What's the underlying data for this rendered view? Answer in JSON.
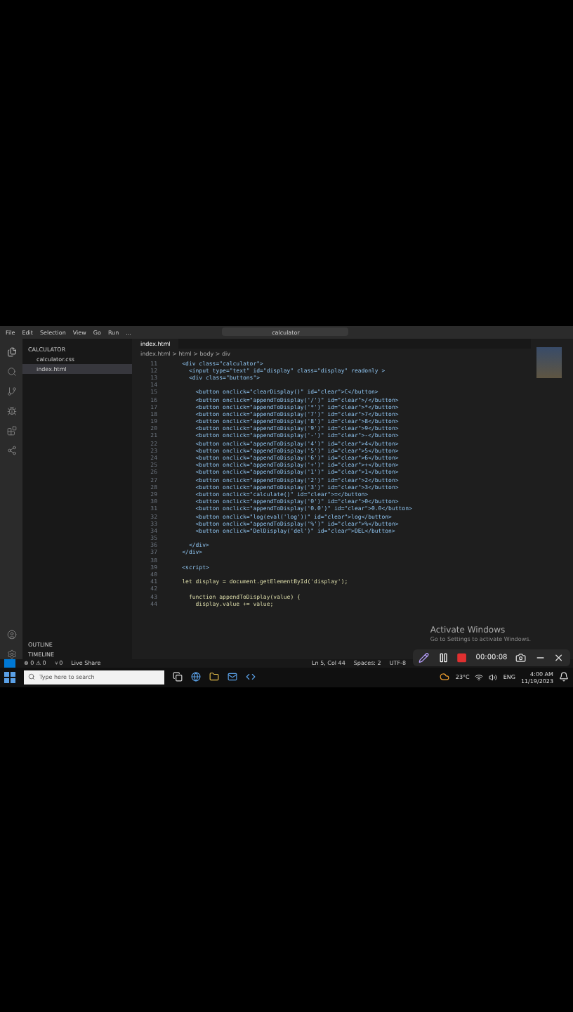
{
  "window": {
    "menu": [
      "File",
      "Edit",
      "Selection",
      "View",
      "Go",
      "Run",
      "..."
    ],
    "search": "calculator"
  },
  "sidebar": {
    "folder": "CALCULATOR",
    "files": [
      {
        "name": "calculator.css",
        "selected": false
      },
      {
        "name": "index.html",
        "selected": true
      }
    ],
    "panels": [
      "OUTLINE",
      "TIMELINE"
    ]
  },
  "editor": {
    "tab": "index.html",
    "breadcrumb": "index.html > html > body > div",
    "lines": [
      {
        "number": "11",
        "text": "    <div class=\"calculator\">",
        "kind": "markup"
      },
      {
        "number": "12",
        "text": "      <input type=\"text\" id=\"display\" class=\"display\" readonly >",
        "kind": "markup"
      },
      {
        "number": "13",
        "text": "      <div class=\"buttons\">",
        "kind": "markup"
      },
      {
        "number": "14",
        "kind": "blank"
      },
      {
        "number": "15",
        "text": "        <button onclick=\"clearDisplay()\" id=\"clear\">C</button>",
        "kind": "markup"
      },
      {
        "number": "16",
        "text": "        <button onclick=\"appendToDisplay('/')\" id=\"clear\">/</button>",
        "kind": "markup"
      },
      {
        "number": "17",
        "text": "        <button onclick=\"appendToDisplay('*')\" id=\"clear\">*</button>",
        "kind": "markup"
      },
      {
        "number": "18",
        "text": "        <button onclick=\"appendToDisplay('7')\" id=\"clear\">7</button>",
        "kind": "markup"
      },
      {
        "number": "19",
        "text": "        <button onclick=\"appendToDisplay('8')\" id=\"clear\">8</button>",
        "kind": "markup"
      },
      {
        "number": "20",
        "text": "        <button onclick=\"appendToDisplay('9')\" id=\"clear\">9</button>",
        "kind": "markup"
      },
      {
        "number": "21",
        "text": "        <button onclick=\"appendToDisplay('-')\" id=\"clear\">-</button>",
        "kind": "markup"
      },
      {
        "number": "22",
        "text": "        <button onclick=\"appendToDisplay('4')\" id=\"clear\">4</button>",
        "kind": "markup"
      },
      {
        "number": "23",
        "text": "        <button onclick=\"appendToDisplay('5')\" id=\"clear\">5</button>",
        "kind": "markup"
      },
      {
        "number": "24",
        "text": "        <button onclick=\"appendToDisplay('6')\" id=\"clear\">6</button>",
        "kind": "markup"
      },
      {
        "number": "25",
        "text": "        <button onclick=\"appendToDisplay('+')\" id=\"clear\">+</button>",
        "kind": "markup"
      },
      {
        "number": "26",
        "text": "        <button onclick=\"appendToDisplay('1')\" id=\"clear\">1</button>",
        "kind": "markup"
      },
      {
        "number": "27",
        "text": "        <button onclick=\"appendToDisplay('2')\" id=\"clear\">2</button>",
        "kind": "markup"
      },
      {
        "number": "28",
        "text": "        <button onclick=\"appendToDisplay('3')\" id=\"clear\">3</button>",
        "kind": "markup"
      },
      {
        "number": "29",
        "text": "        <button onclick=\"calculate()\" id=\"clear\">=</button>",
        "kind": "markup"
      },
      {
        "number": "30",
        "text": "        <button onclick=\"appendToDisplay('0')\" id=\"clear\">0</button>",
        "kind": "markup"
      },
      {
        "number": "31",
        "text": "        <button onclick=\"appendToDisplay('0.0')\" id=\"clear\">0.0</button>",
        "kind": "markup"
      },
      {
        "number": "32",
        "text": "        <button onclick=\"log(eval('log'))\" id=\"clear\">log</button>",
        "kind": "markup"
      },
      {
        "number": "33",
        "text": "        <button onclick=\"appendToDisplay('%')\" id=\"clear\">%</button>",
        "kind": "markup"
      },
      {
        "number": "34",
        "text": "        <button onclick=\"DelDisplay('del')\" id=\"clear\">DEL</button>",
        "kind": "markup"
      },
      {
        "number": "35",
        "kind": "blank"
      },
      {
        "number": "36",
        "text": "      </div>",
        "kind": "markup"
      },
      {
        "number": "37",
        "text": "    </div>",
        "kind": "markup"
      },
      {
        "number": "38",
        "kind": "blank"
      },
      {
        "number": "39",
        "text": "    <script>",
        "kind": "markup"
      },
      {
        "number": "40",
        "kind": "blank"
      },
      {
        "number": "41",
        "text": "    let display = document.getElementById('display');",
        "kind": "script"
      },
      {
        "number": "42",
        "kind": "blank"
      },
      {
        "number": "43",
        "text": "      function appendToDisplay(value) {",
        "kind": "script"
      },
      {
        "number": "44",
        "text": "        display.value += value;",
        "kind": "script"
      }
    ]
  },
  "status_bar": {
    "left": [
      "⊗ 0 ⚠ 0",
      "⑂ 0",
      "Live Share"
    ],
    "right": [
      "Ln 5, Col 44",
      "Spaces: 2",
      "UTF-8"
    ]
  },
  "activation": {
    "title": "Activate Windows",
    "subtitle": "Go to Settings to activate Windows."
  },
  "recorder": {
    "time": "00:00:08"
  },
  "taskbar": {
    "search_placeholder": "Type here to search",
    "weather": "23°C",
    "language": "ENG",
    "time": "4:00 AM",
    "date": "11/19/2023"
  }
}
